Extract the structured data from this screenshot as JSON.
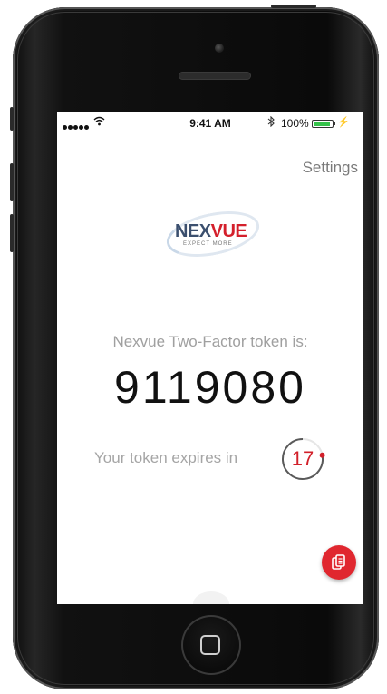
{
  "status_bar": {
    "time": "9:41 AM",
    "battery": "100%",
    "wifi_icon": "wifi-icon",
    "bluetooth_icon": "bluetooth-icon"
  },
  "header": {
    "settings_label": "Settings"
  },
  "logo": {
    "brand_part1": "NEX",
    "brand_part2": "VUE",
    "tagline": "EXPECT MORE"
  },
  "token": {
    "label": "Nexvue Two-Factor token is:",
    "value": "9119080",
    "expires_label": "Your token expires in",
    "seconds_remaining": "17"
  },
  "actions": {
    "copy_icon": "copy-icon"
  },
  "colors": {
    "accent": "#e0272f",
    "logo_navy": "#3b4f6e",
    "battery_green": "#35c24a"
  }
}
